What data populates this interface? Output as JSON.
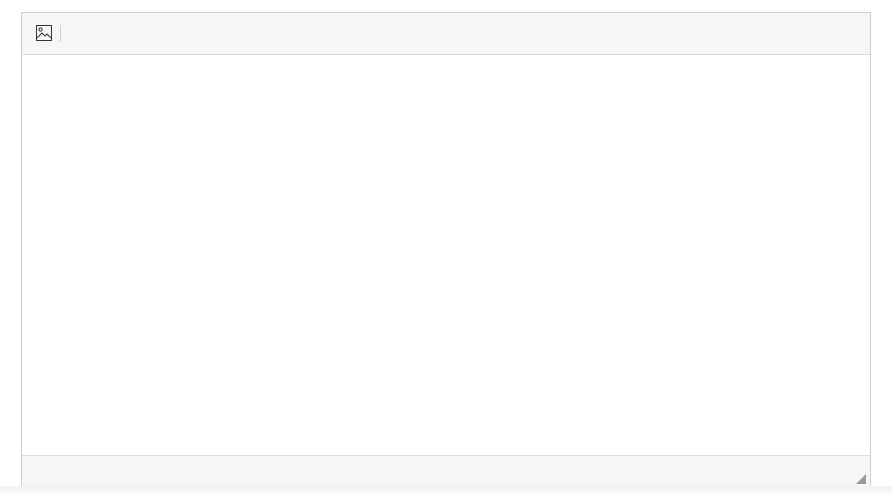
{
  "editor": {
    "toolbar": {
      "buttons": [
        {
          "icon": "image-icon",
          "label": ""
        }
      ]
    },
    "content": {
      "value": ""
    },
    "statusbar": {
      "path": "",
      "resize_icon": "resize-handle-icon"
    }
  },
  "colors": {
    "border": "#cfcfcf",
    "toolbar_bg": "#f6f6f6",
    "icon": "#333333",
    "content_bg": "#ffffff"
  }
}
